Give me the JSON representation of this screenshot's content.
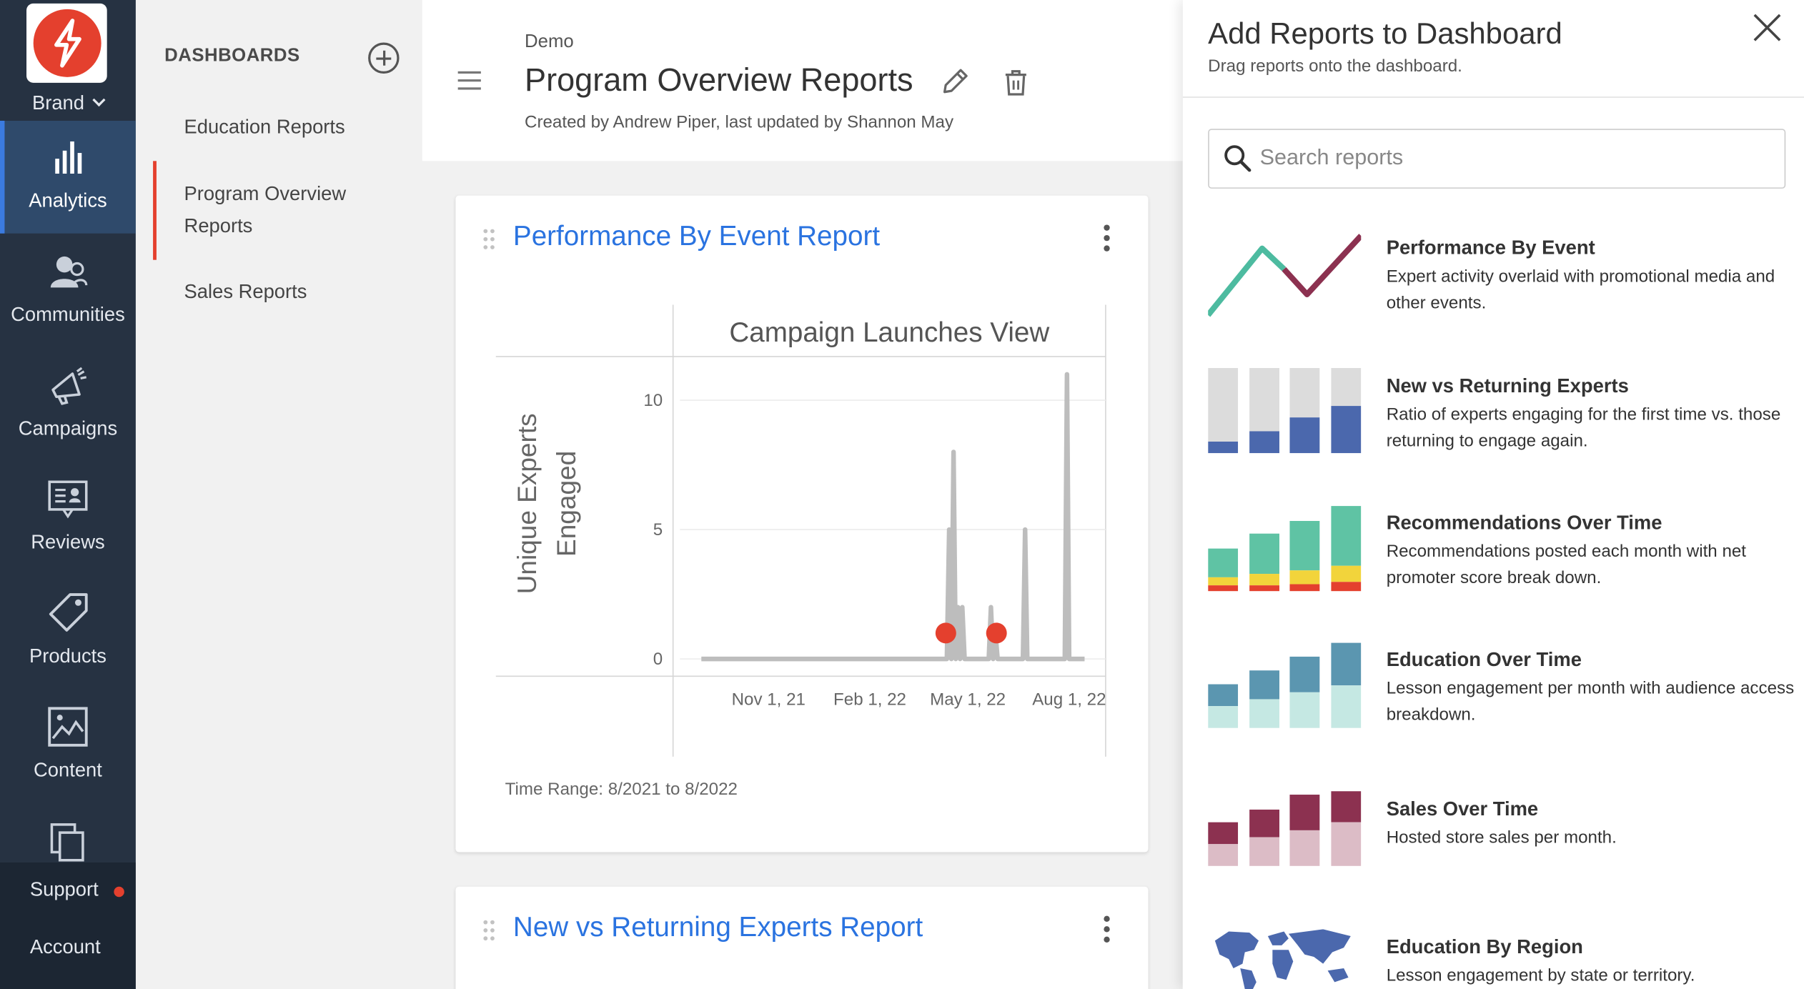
{
  "nav": {
    "brand": "Brand",
    "items": [
      {
        "label": "Analytics"
      },
      {
        "label": "Communities"
      },
      {
        "label": "Campaigns"
      },
      {
        "label": "Reviews"
      },
      {
        "label": "Products"
      },
      {
        "label": "Content"
      }
    ],
    "support": "Support",
    "account": "Account"
  },
  "dashboards": {
    "heading": "DASHBOARDS",
    "items": [
      {
        "label": "Education Reports"
      },
      {
        "label": "Program Overview Reports",
        "active": true
      },
      {
        "label": "Sales Reports"
      }
    ]
  },
  "header": {
    "breadcrumb": "Demo",
    "title": "Program Overview Reports",
    "meta": "Created by Andrew Piper, last updated by Shannon May"
  },
  "cards": [
    {
      "title": "Performance By Event Report",
      "time_range": "Time Range: 8/2021 to 8/2022"
    },
    {
      "title": "New vs Returning Experts Report"
    }
  ],
  "chart_data": {
    "type": "line",
    "title": "Campaign Launches View",
    "ylabel": "Unique Experts Engaged",
    "xlabel": "",
    "x_ticks": [
      "Nov 1, 21",
      "Feb 1, 22",
      "May 1, 22",
      "Aug 1, 22"
    ],
    "y_ticks": [
      0,
      5,
      10
    ],
    "ylim": [
      0,
      11.5
    ],
    "xlim": [
      "2021-08-23",
      "2022-08-31"
    ],
    "series": [
      {
        "x": [
          "2021-09-01",
          "2022-04-12",
          "2022-04-14",
          "2022-04-16",
          "2022-04-18",
          "2022-04-20",
          "2022-04-22",
          "2022-04-24",
          "2022-04-26",
          "2022-04-28",
          "2022-04-30",
          "2022-05-02",
          "2022-05-04",
          "2022-05-20",
          "2022-05-22",
          "2022-05-24",
          "2022-05-26",
          "2022-05-28",
          "2022-06-20",
          "2022-06-22",
          "2022-06-24",
          "2022-07-28",
          "2022-07-30",
          "2022-08-01",
          "2022-08-15"
        ],
        "y": [
          0,
          0,
          5,
          0,
          8,
          0,
          2,
          0,
          2,
          0,
          0,
          0,
          0,
          0,
          2,
          0,
          1,
          0,
          0,
          5,
          0,
          0,
          11,
          0,
          0
        ],
        "color": "#bdbdbd"
      }
    ],
    "events": [
      {
        "x": "2022-04-11",
        "y": 1
      },
      {
        "x": "2022-05-27",
        "y": 1
      }
    ],
    "event_color": "#e4402e",
    "grid": true,
    "legend": "none"
  },
  "panel": {
    "title": "Add Reports to Dashboard",
    "subtitle": "Drag reports onto the dashboard.",
    "search_placeholder": "Search reports",
    "reports": [
      {
        "name": "Performance By Event",
        "desc": "Expert activity overlaid with promotional media and other events."
      },
      {
        "name": "New vs Returning Experts",
        "desc": "Ratio of experts engaging for the first time vs. those returning to engage again."
      },
      {
        "name": "Recommendations Over Time",
        "desc": "Recommendations posted each month with net promoter score break down."
      },
      {
        "name": "Education Over Time",
        "desc": "Lesson engagement per month with audience access breakdown."
      },
      {
        "name": "Sales Over Time",
        "desc": "Hosted store sales per month."
      },
      {
        "name": "Education By Region",
        "desc": "Lesson engagement by state or territory."
      }
    ]
  },
  "colors": {
    "nav_bg": "#263242",
    "nav_active": "#2f4a6b",
    "accent_red": "#e4402e",
    "link_blue": "#2a73e0"
  }
}
